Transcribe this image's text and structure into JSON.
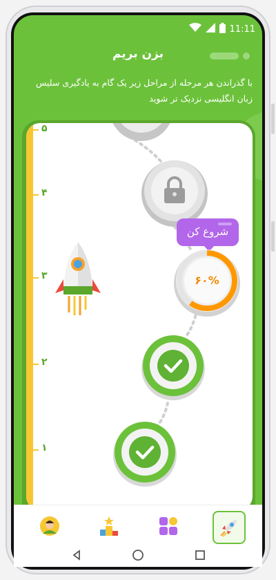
{
  "status_bar": {
    "time": "11:11"
  },
  "header": {
    "title": "بزن بریم",
    "description": "با گذراندن هر مرحله از مراحل زیر یک گام به یادگیری سلیس زبان انگلیسی نزدیک تر شوید"
  },
  "ruler": {
    "labels": [
      "۵",
      "۴",
      "۳",
      "۲",
      "۱"
    ]
  },
  "levels": [
    {
      "state": "locked",
      "icon": "lock-icon"
    },
    {
      "state": "locked",
      "icon": "lock-icon"
    },
    {
      "state": "in-progress",
      "progress_label": "۶۰%",
      "progress": 0.6
    },
    {
      "state": "completed",
      "icon": "checkmark-icon"
    },
    {
      "state": "completed",
      "icon": "checkmark-icon"
    }
  ],
  "tooltip": {
    "label": "شروع کن"
  },
  "bottom_nav": {
    "items": [
      {
        "icon": "avatar-icon"
      },
      {
        "icon": "leaderboard-icon"
      },
      {
        "icon": "apps-grid-icon"
      },
      {
        "icon": "rocket-icon",
        "active": true
      }
    ]
  },
  "colors": {
    "primary": "#6cc13b",
    "accent": "#ff9800",
    "tooltip": "#b266ea",
    "ruler": "#f7c733"
  }
}
